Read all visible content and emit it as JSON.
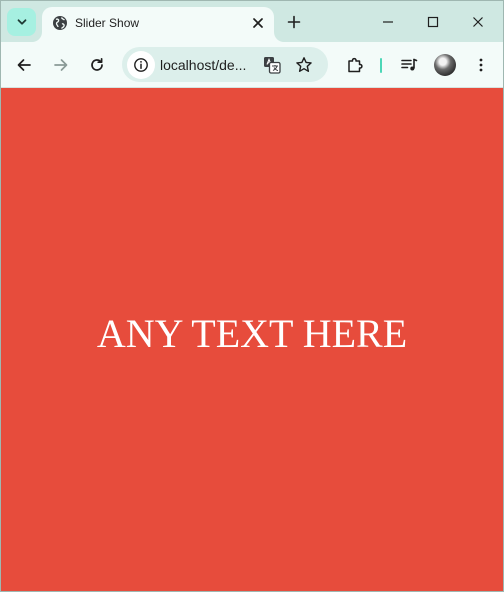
{
  "browser": {
    "tab": {
      "title": "Slider Show",
      "favicon": "globe-icon"
    },
    "omnibox": {
      "url": "localhost/de..."
    },
    "accent_color": "#4cd7b7",
    "tab_search_color": "#a6f0e1"
  },
  "page": {
    "background_color": "#e74c3c",
    "slide_text": "ANY TEXT HERE",
    "text_color": "#ffffff"
  }
}
